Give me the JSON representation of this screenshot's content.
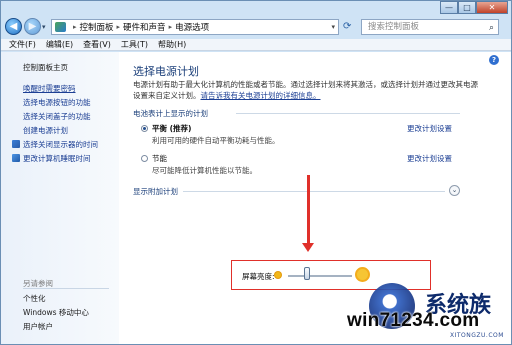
{
  "window": {
    "controls": {
      "minimize": "—",
      "maximize": "□",
      "close": "✕"
    }
  },
  "address": {
    "crumbs": [
      "控制面板",
      "硬件和声音",
      "电源选项"
    ],
    "separator": "▸",
    "back_glyph": "◀",
    "forward_glyph": "▶",
    "search_placeholder": "搜索控制面板"
  },
  "menu": {
    "items": [
      "文件(F)",
      "编辑(E)",
      "查看(V)",
      "工具(T)",
      "帮助(H)"
    ]
  },
  "sidebar": {
    "items": [
      {
        "label": "控制面板主页"
      },
      {
        "label": "唤醒时需要密码"
      },
      {
        "label": "选择电源按钮的功能"
      },
      {
        "label": "选择关闭盖子的功能"
      },
      {
        "label": "创建电源计划"
      },
      {
        "label": "选择关闭显示器的时间"
      },
      {
        "label": "更改计算机睡眠时间"
      }
    ],
    "see_also_title": "另请参阅",
    "see_also": [
      "个性化",
      "Windows 移动中心",
      "用户帐户"
    ]
  },
  "main": {
    "title": "选择电源计划",
    "description": "电源计划有助于最大化计算机的性能或者节能。通过选择计划来将其激活，或选择计划并通过更改其电源设置来自定义计划。",
    "description_link": "请告诉我有关电源计划的详细信息。",
    "group_head": "电池表计上显示的计划",
    "plans": [
      {
        "name": "平衡 (推荐)",
        "desc": "利用可用的硬件自动平衡功耗与性能。",
        "link": "更改计划设置",
        "selected": true
      },
      {
        "name": "节能",
        "desc": "尽可能降低计算机性能以节能。",
        "link": "更改计划设置",
        "selected": false
      }
    ],
    "additional_plans": "显示附加计划"
  },
  "brightness": {
    "label": "屏幕亮度:",
    "level_fraction": 0.3
  },
  "watermark": {
    "brand": "系统族",
    "site": "win71234.com",
    "small": "XITONGZU.COM"
  },
  "colors": {
    "accent_red": "#e0302a",
    "link_blue": "#1c3f94"
  }
}
